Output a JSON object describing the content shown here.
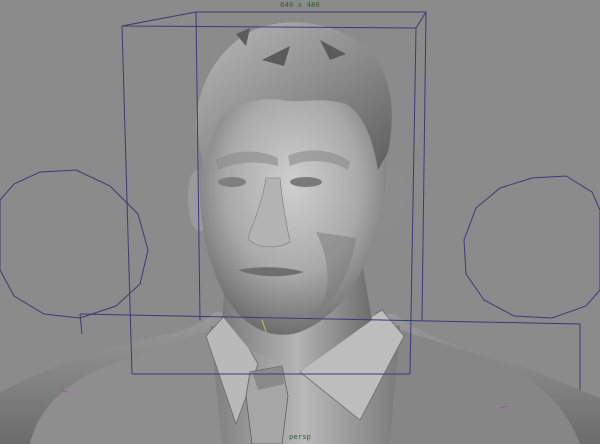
{
  "viewport": {
    "resolution_gate_label": "640 x 480",
    "camera_label": "persp"
  },
  "colors": {
    "background": "#8b8b8b",
    "wireframe": "#3b3b7a",
    "hud_text": "#2f5f2f",
    "mesh_light": "#c4c4c4",
    "mesh_mid": "#9d9d9d",
    "mesh_dark": "#5a5a5a"
  }
}
